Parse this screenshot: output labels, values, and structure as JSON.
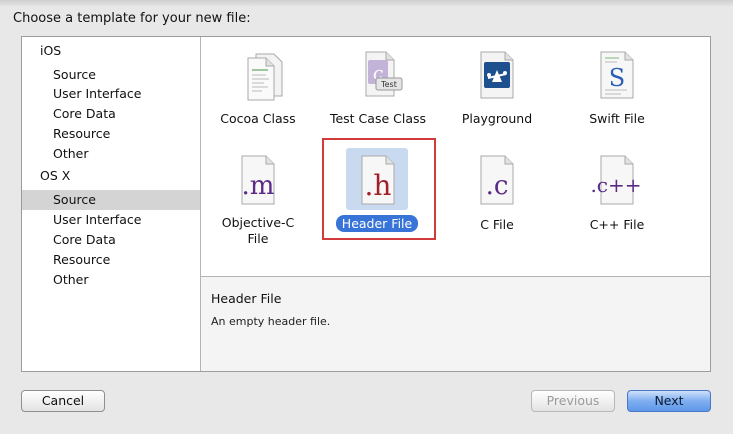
{
  "dialog": {
    "title": "Choose a template for your new file:"
  },
  "sidebar": {
    "groups": [
      {
        "label": "iOS",
        "items": [
          "Source",
          "User Interface",
          "Core Data",
          "Resource",
          "Other"
        ]
      },
      {
        "label": "OS X",
        "items": [
          "Source",
          "User Interface",
          "Core Data",
          "Resource",
          "Other"
        ]
      }
    ],
    "selected": "OS X / Source"
  },
  "templates": [
    {
      "label": "Cocoa Class",
      "icon": "cocoa-class-icon"
    },
    {
      "label": "Test Case Class",
      "icon": "test-case-class-icon",
      "badge": "Test"
    },
    {
      "label": "Playground",
      "icon": "playground-icon"
    },
    {
      "label": "Swift File",
      "icon": "swift-file-icon",
      "glyph": "S"
    },
    {
      "label": "Objective-C File",
      "line1": "Objective-C",
      "line2": "File",
      "icon": "objective-c-file-icon",
      "glyph": ".m"
    },
    {
      "label": "Header File",
      "icon": "header-file-icon",
      "glyph": ".h",
      "selected": true
    },
    {
      "label": "C File",
      "icon": "c-file-icon",
      "glyph": ".c"
    },
    {
      "label": "C++ File",
      "icon": "cpp-file-icon",
      "glyph": ".c++"
    }
  ],
  "description": {
    "title": "Header File",
    "text": "An empty header file."
  },
  "buttons": {
    "cancel": "Cancel",
    "previous": "Previous",
    "next": "Next"
  },
  "colors": {
    "selection_blue": "#3874d8",
    "highlight_red": "#d23a3a",
    "glyph_purple": "#5b2a86",
    "glyph_red": "#a3202a"
  }
}
